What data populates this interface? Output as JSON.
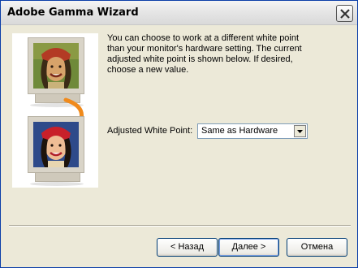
{
  "window": {
    "title": "Adobe Gamma Wizard"
  },
  "main": {
    "description": "You can choose to work at a different white point than your monitor's hardware setting. The current adjusted white point is shown below. If desired, choose a new value.",
    "white_point_label": "Adjusted White Point:",
    "white_point_value": "Same as Hardware"
  },
  "buttons": {
    "back": "< Назад",
    "next": "Далее >",
    "cancel": "Отмена"
  },
  "icons": {
    "close": "close-icon",
    "dropdown": "chevron-down-icon",
    "transition": "curved-arrow-icon"
  },
  "colors": {
    "arrow": "#f08a1c",
    "button_border": "#003c74",
    "dialog_bg": "#ece9d8"
  }
}
